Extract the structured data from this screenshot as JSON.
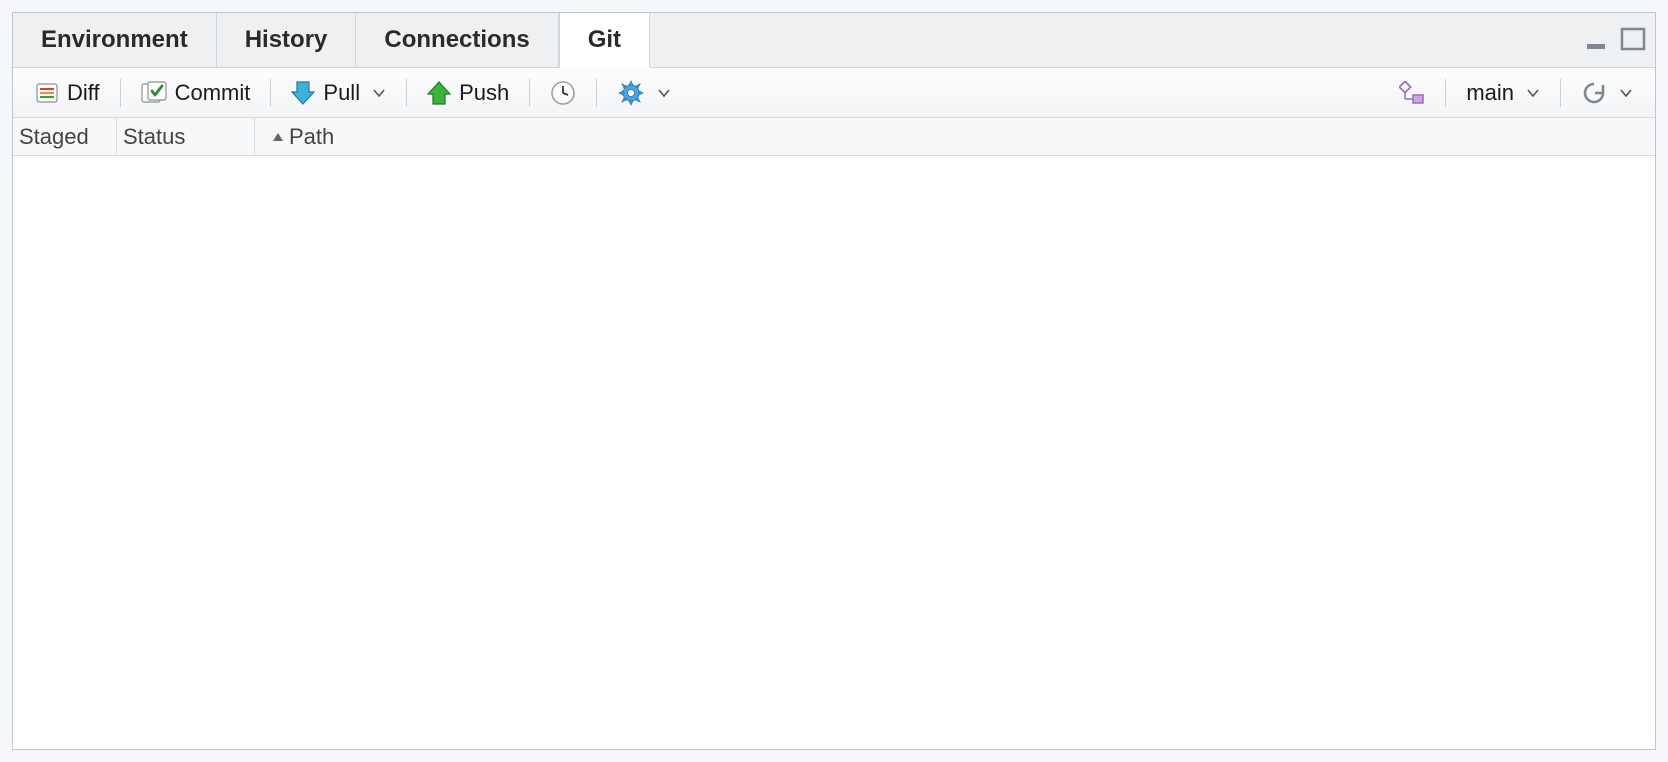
{
  "tabs": {
    "environment": "Environment",
    "history": "History",
    "connections": "Connections",
    "git": "Git"
  },
  "toolbar": {
    "diff_label": "Diff",
    "commit_label": "Commit",
    "pull_label": "Pull",
    "push_label": "Push",
    "branch_label": "main"
  },
  "columns": {
    "staged": "Staged",
    "status": "Status",
    "path": "Path"
  }
}
